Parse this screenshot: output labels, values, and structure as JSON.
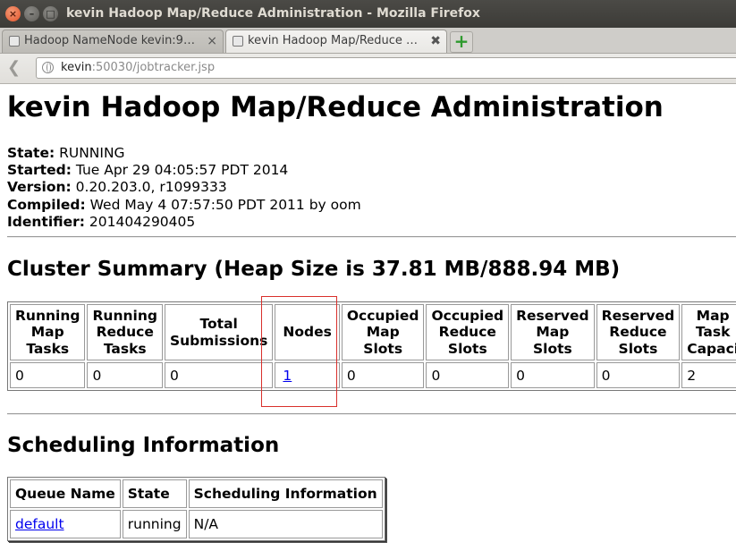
{
  "window": {
    "title": "kevin Hadoop Map/Reduce Administration - Mozilla Firefox",
    "close_glyph": "×",
    "min_glyph": "–",
    "max_glyph": "□"
  },
  "tabs": [
    {
      "label": "Hadoop NameNode kevin:9…",
      "close": "×"
    },
    {
      "label": "kevin Hadoop Map/Reduce …",
      "close": "✖"
    }
  ],
  "new_tab_glyph": "+",
  "nav": {
    "back_glyph": "❮",
    "url_host": "kevin",
    "url_path": ":50030/jobtracker.jsp"
  },
  "page": {
    "heading": "kevin Hadoop Map/Reduce Administration",
    "info": [
      {
        "label": "State:",
        "value": " RUNNING"
      },
      {
        "label": "Started:",
        "value": " Tue Apr 29 04:05:57 PDT 2014"
      },
      {
        "label": "Version:",
        "value": " 0.20.203.0, r1099333"
      },
      {
        "label": "Compiled:",
        "value": " Wed May 4 07:57:50 PDT 2011 by oom"
      },
      {
        "label": "Identifier:",
        "value": " 201404290405"
      }
    ],
    "cluster_title": "Cluster Summary (Heap Size is 37.81 MB/888.94 MB)",
    "cluster_table": {
      "headers": [
        [
          "Running",
          "Map",
          "Tasks"
        ],
        [
          "Running",
          "Reduce",
          "Tasks"
        ],
        [
          "Total",
          "Submissions"
        ],
        [
          "Nodes"
        ],
        [
          "Occupied",
          "Map",
          "Slots"
        ],
        [
          "Occupied",
          "Reduce",
          "Slots"
        ],
        [
          "Reserved",
          "Map",
          "Slots"
        ],
        [
          "Reserved",
          "Reduce",
          "Slots"
        ],
        [
          "Map",
          "Task",
          "Capaci"
        ]
      ],
      "values": [
        "0",
        "0",
        "0",
        "1",
        "0",
        "0",
        "0",
        "0",
        "2"
      ]
    },
    "scheduling_title": "Scheduling Information",
    "scheduling_table": {
      "headers": [
        "Queue Name",
        "State",
        "Scheduling Information"
      ],
      "rows": [
        {
          "queue": "default",
          "state": "running",
          "info": "N/A"
        }
      ]
    }
  }
}
